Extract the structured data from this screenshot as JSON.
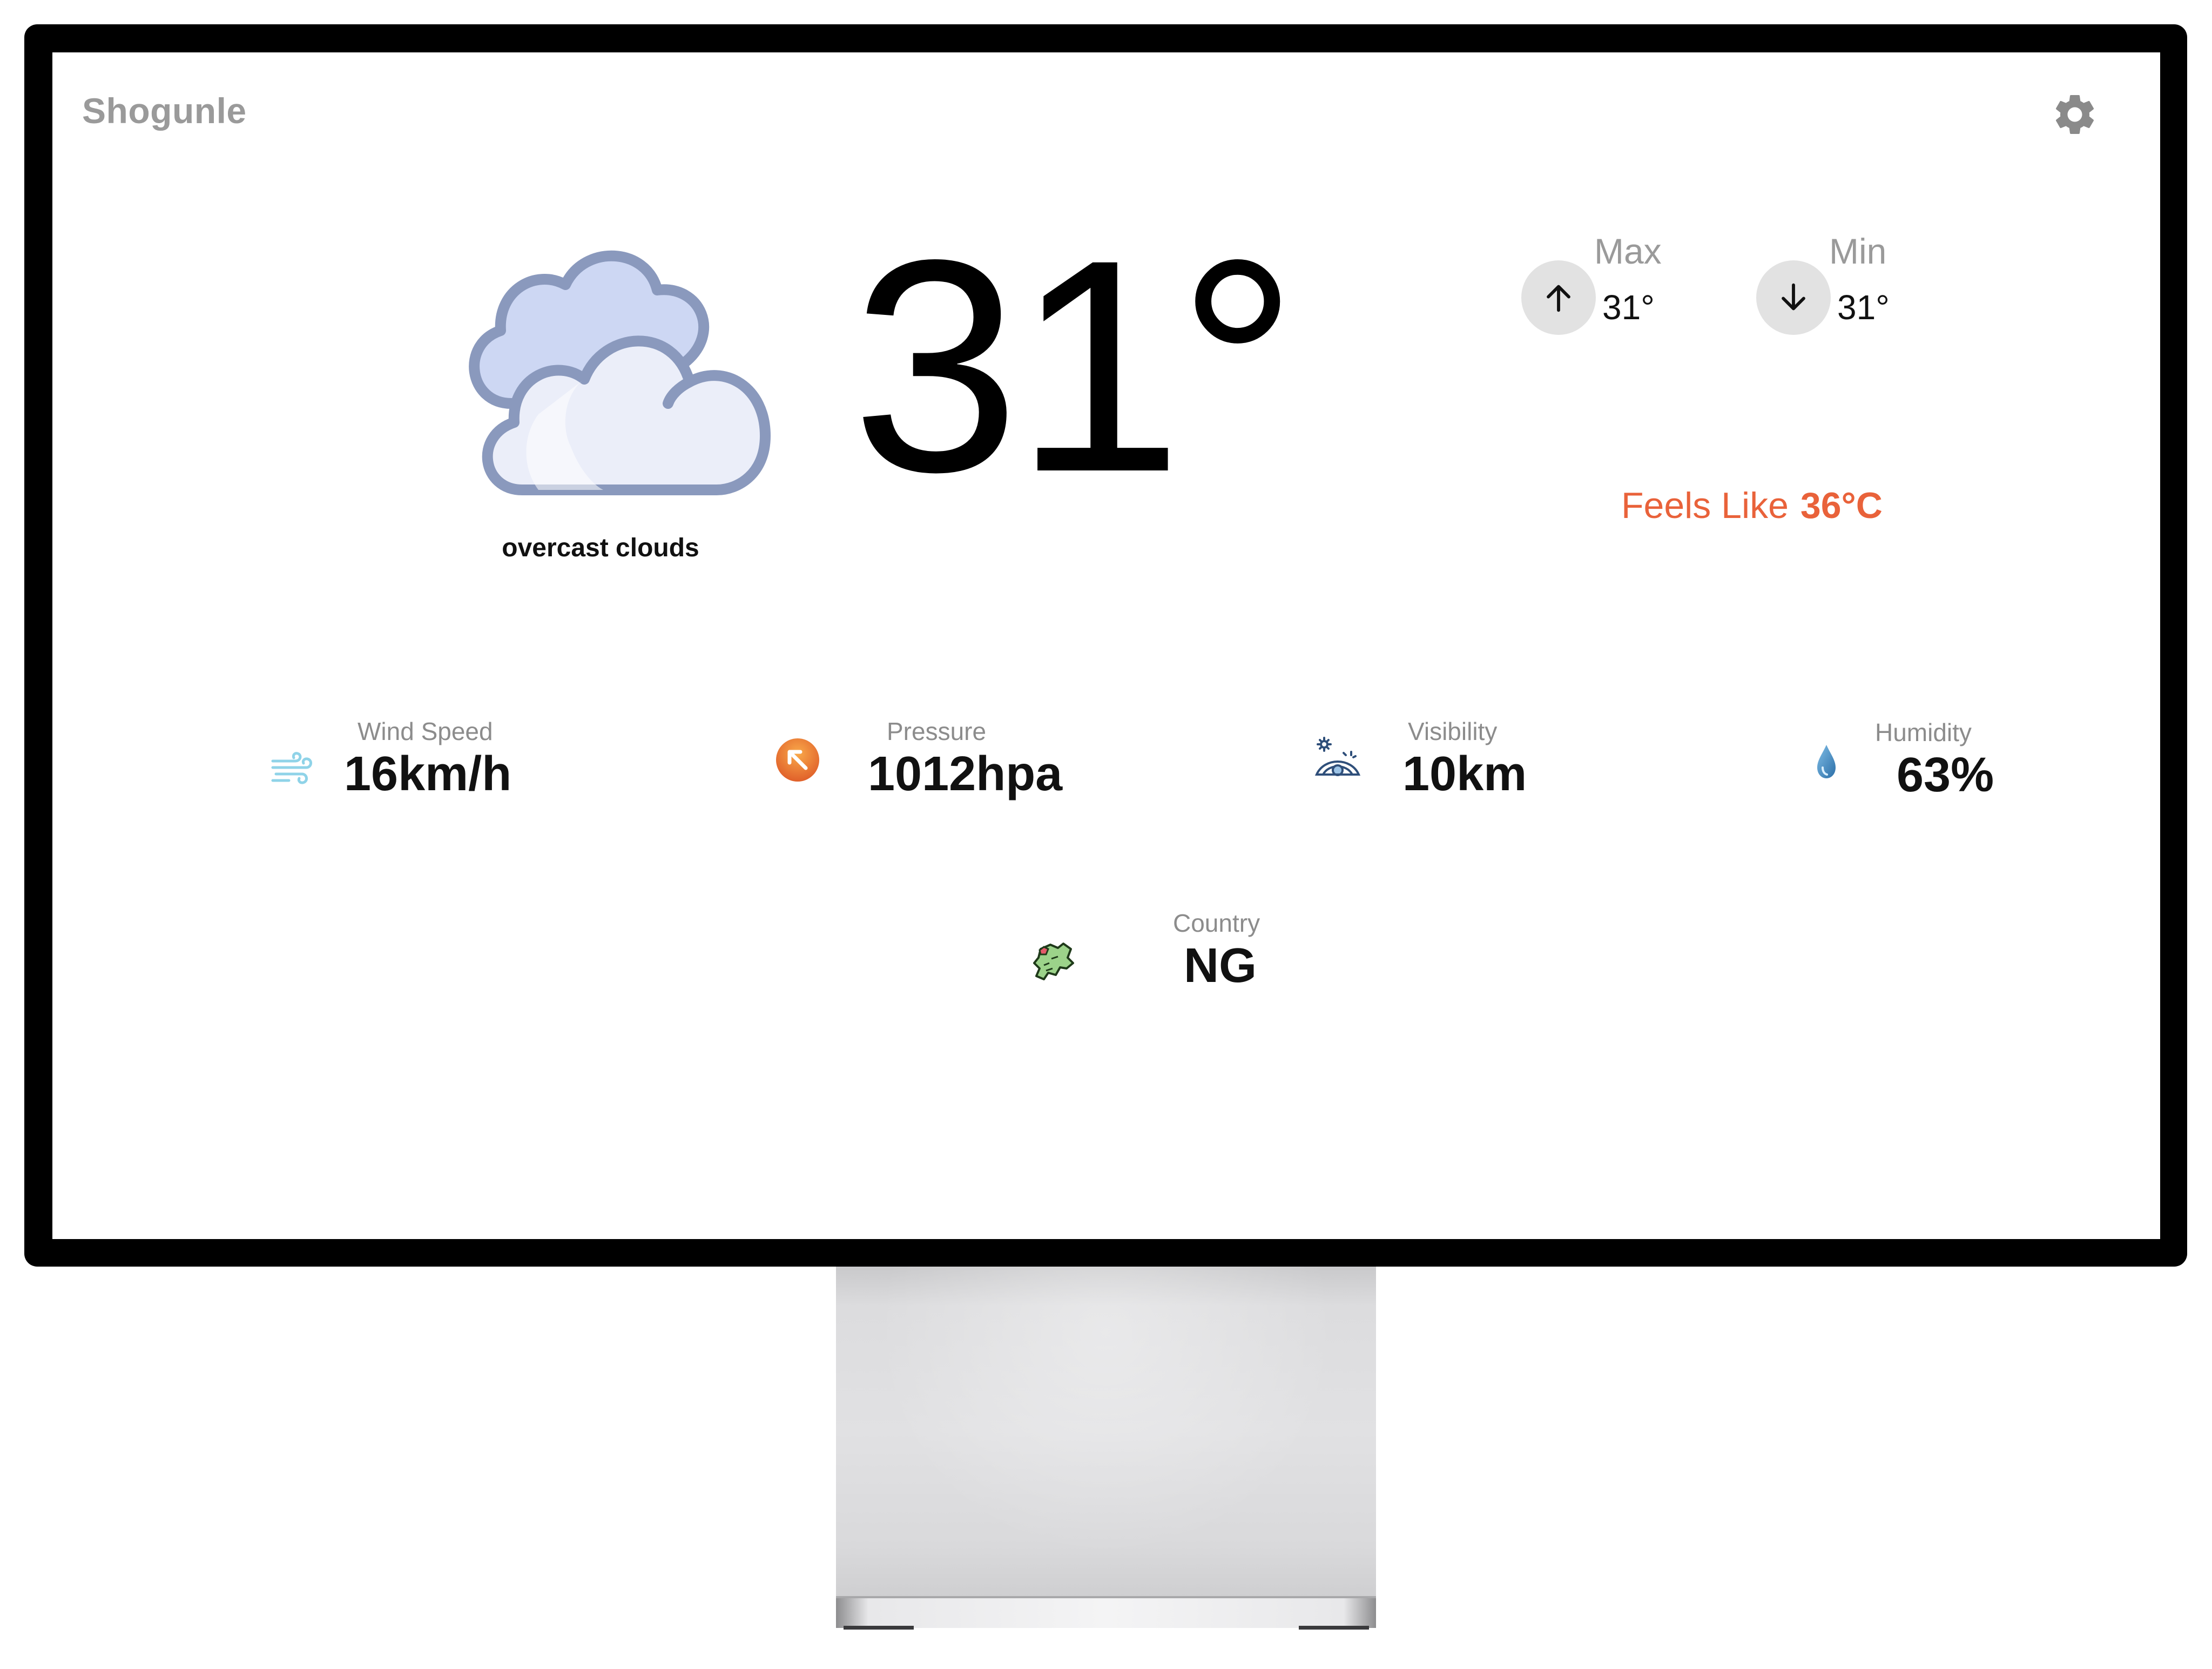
{
  "app": {
    "brand": "Shogunle",
    "settings_icon": "gear-icon"
  },
  "current": {
    "icon": "overcast-clouds-icon",
    "description": "overcast clouds",
    "temperature": "31°"
  },
  "max": {
    "label": "Max",
    "value": "31°",
    "icon": "arrow-up-icon"
  },
  "min": {
    "label": "Min",
    "value": "31°",
    "icon": "arrow-down-icon"
  },
  "feels_like": {
    "label": "Feels Like",
    "value": "36°C",
    "color": "#e9623a"
  },
  "stats": {
    "wind": {
      "label": "Wind Speed",
      "value": "16km/h",
      "icon": "wind-icon"
    },
    "pressure": {
      "label": "Pressure",
      "value": "1012hpa",
      "icon": "pressure-arrow-icon"
    },
    "visibility": {
      "label": "Visibility",
      "value": "10km",
      "icon": "visibility-eye-icon"
    },
    "humidity": {
      "label": "Humidity",
      "value": "63%",
      "icon": "water-drop-icon"
    },
    "country": {
      "label": "Country",
      "value": "NG",
      "icon": "country-map-icon"
    }
  }
}
